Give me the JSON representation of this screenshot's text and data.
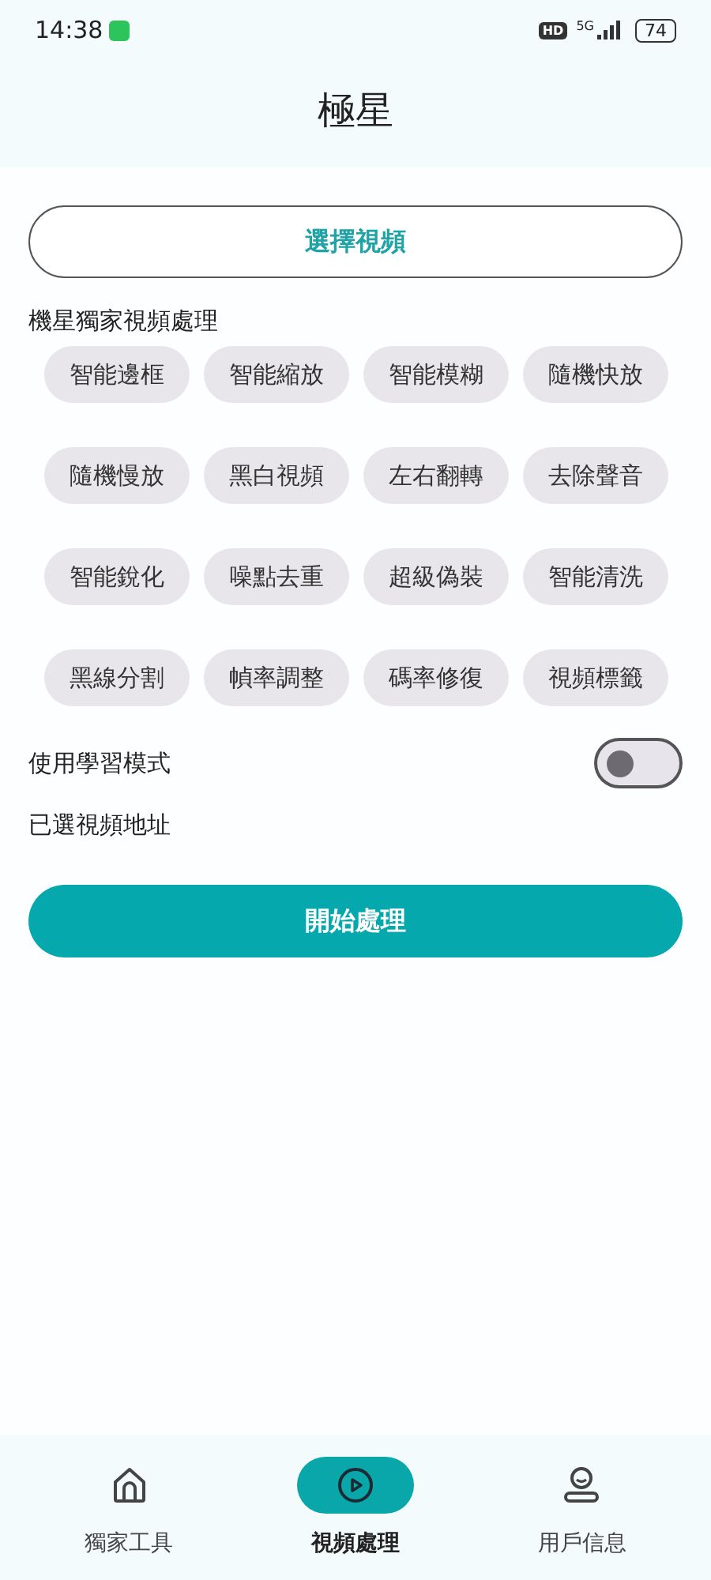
{
  "status_bar": {
    "time": "14:38",
    "hd": "HD",
    "network": "5G",
    "battery": "74"
  },
  "header": {
    "title": "極星"
  },
  "select_button": "選擇視頻",
  "section_title": "機星獨家視頻處理",
  "features": [
    "智能邊框",
    "智能縮放",
    "智能模糊",
    "隨機快放",
    "隨機慢放",
    "黑白視頻",
    "左右翻轉",
    "去除聲音",
    "智能銳化",
    "噪點去重",
    "超級偽裝",
    "智能清洗",
    "黑線分割",
    "幀率調整",
    "碼率修復",
    "視頻標籤"
  ],
  "learning_mode": {
    "label": "使用學習模式",
    "on": false
  },
  "selected_path_label": "已選視頻地址",
  "start_button": "開始處理",
  "bottom_nav": [
    {
      "kind": "home",
      "label": "獨家工具",
      "selected": false
    },
    {
      "kind": "play",
      "label": "視頻處理",
      "selected": true
    },
    {
      "kind": "user",
      "label": "用戶信息",
      "selected": false
    }
  ]
}
